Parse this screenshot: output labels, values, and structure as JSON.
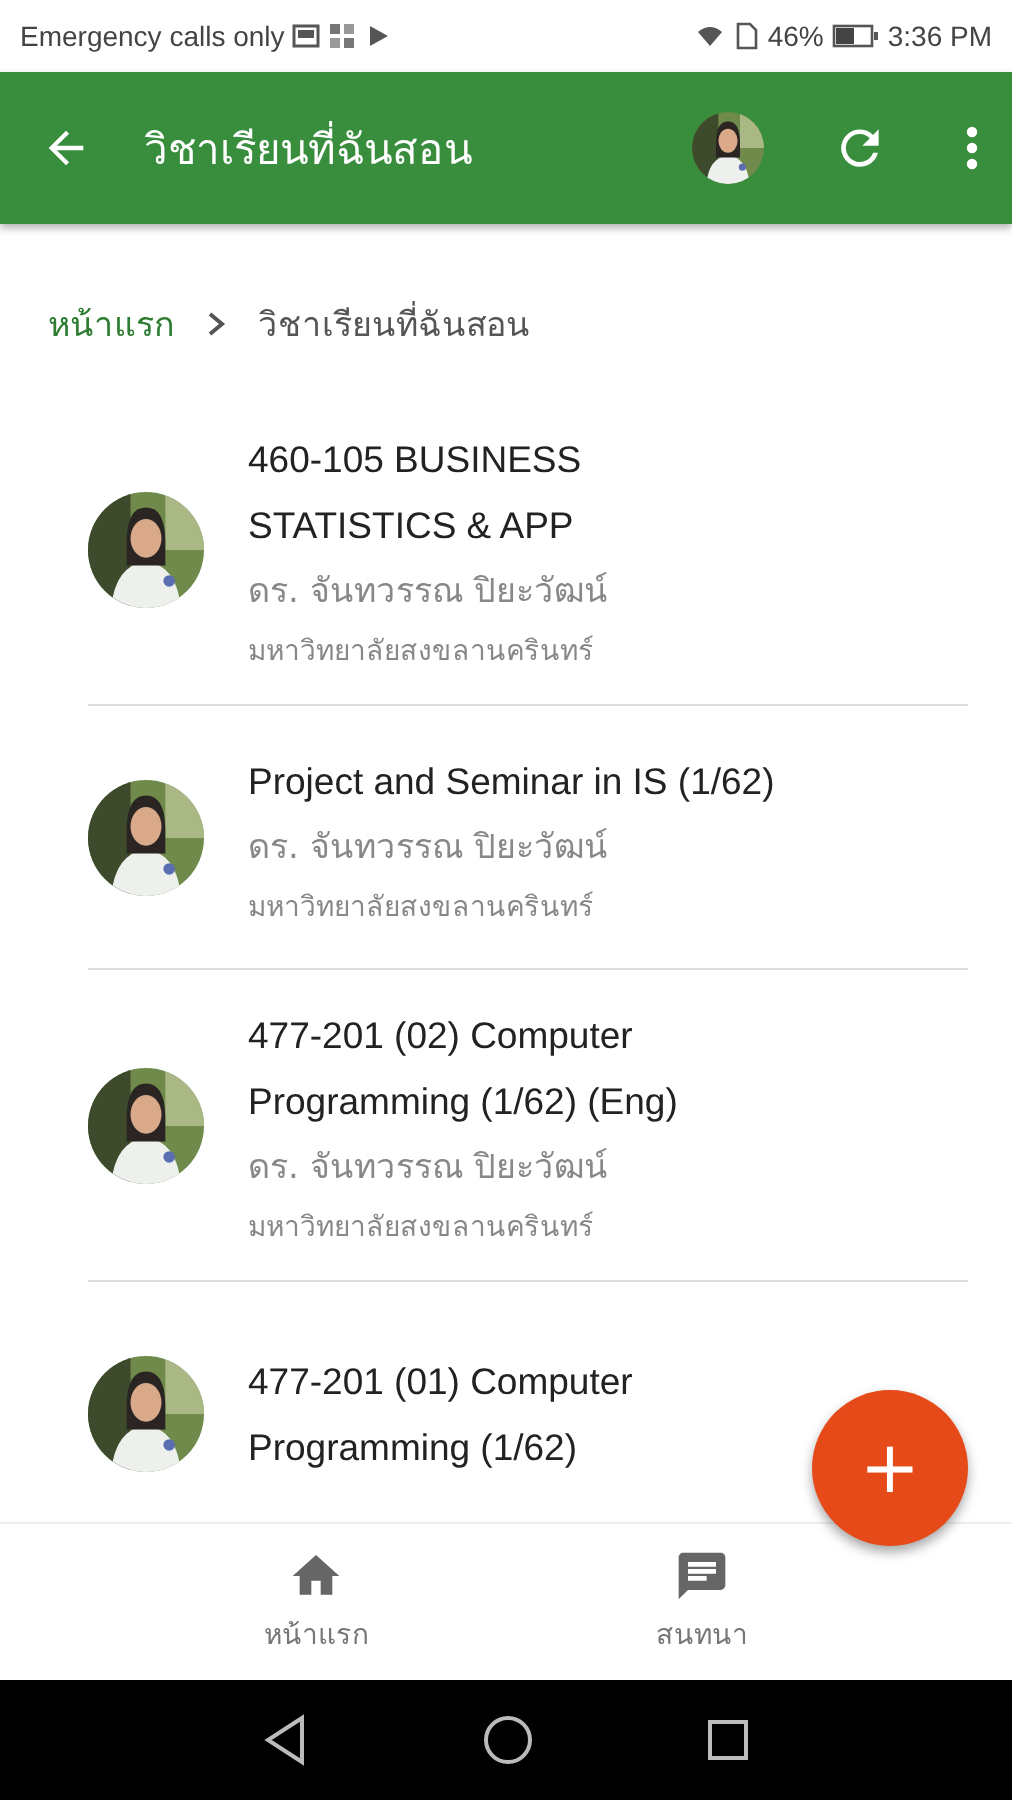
{
  "status_bar": {
    "carrier": "Emergency calls only",
    "battery": "46%",
    "time": "3:36 PM"
  },
  "app_bar": {
    "title": "วิชาเรียนที่ฉันสอน"
  },
  "breadcrumb": [
    {
      "label": "หน้าแรก",
      "selected": false
    },
    {
      "label": "วิชาเรียนที่ฉันสอน",
      "selected": true
    }
  ],
  "courses": [
    {
      "title": "460-105 BUSINESS STATISTICS & APP",
      "teacher": "ดร. จันทวรรณ ปิยะวัฒน์",
      "university": "มหาวิทยาลัยสงขลานครินทร์"
    },
    {
      "title": "Project and Seminar in IS (1/62)",
      "teacher": "ดร. จันทวรรณ ปิยะวัฒน์",
      "university": "มหาวิทยาลัยสงขลานครินทร์"
    },
    {
      "title": "477-201 (02) Computer Programming (1/62) (Eng)",
      "teacher": "ดร. จันทวรรณ ปิยะวัฒน์",
      "university": "มหาวิทยาลัยสงขลานครินทร์"
    },
    {
      "title": "477-201 (01) Computer Programming (1/62)"
    }
  ],
  "fab": {
    "label": "+"
  },
  "bottom_nav": [
    {
      "kind": "home",
      "label": "หน้าแรก"
    },
    {
      "kind": "chat",
      "label": "สนทนา"
    }
  ]
}
